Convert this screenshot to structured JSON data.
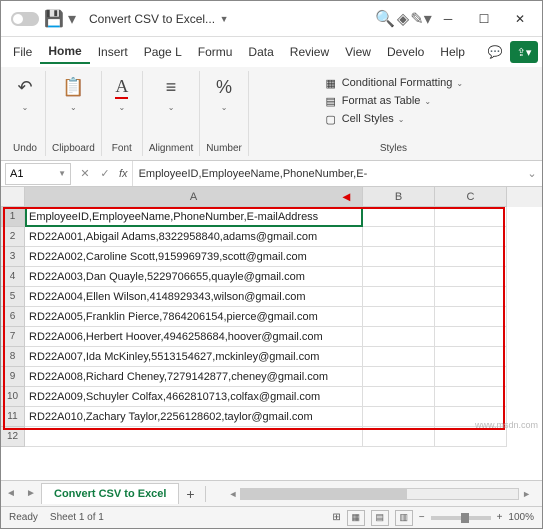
{
  "titlebar": {
    "doc_title": "Convert CSV to Excel..."
  },
  "menubar": {
    "tabs": [
      "File",
      "Home",
      "Insert",
      "Page L",
      "Formu",
      "Data",
      "Review",
      "View",
      "Develo",
      "Help"
    ],
    "active_index": 1
  },
  "ribbon": {
    "undo": "Undo",
    "clipboard": "Clipboard",
    "font": "Font",
    "alignment": "Alignment",
    "number": "Number",
    "styles_label": "Styles",
    "cond_fmt": "Conditional Formatting",
    "fmt_table": "Format as Table",
    "cell_styles": "Cell Styles"
  },
  "formula_bar": {
    "name_box": "A1",
    "content": "EmployeeID,EmployeeName,PhoneNumber,E-"
  },
  "columns": [
    "A",
    "B",
    "C"
  ],
  "rows": [
    {
      "n": 1,
      "a": "EmployeeID,EmployeeName,PhoneNumber,E-mailAddress"
    },
    {
      "n": 2,
      "a": "RD22A001,Abigail Adams,8322958840,adams@gmail.com"
    },
    {
      "n": 3,
      "a": "RD22A002,Caroline Scott,9159969739,scott@gmail.com"
    },
    {
      "n": 4,
      "a": "RD22A003,Dan Quayle,5229706655,quayle@gmail.com"
    },
    {
      "n": 5,
      "a": "RD22A004,Ellen Wilson,4148929343,wilson@gmail.com"
    },
    {
      "n": 6,
      "a": "RD22A005,Franklin Pierce,7864206154,pierce@gmail.com"
    },
    {
      "n": 7,
      "a": "RD22A006,Herbert Hoover,4946258684,hoover@gmail.com"
    },
    {
      "n": 8,
      "a": "RD22A007,Ida McKinley,5513154627,mckinley@gmail.com"
    },
    {
      "n": 9,
      "a": "RD22A008,Richard Cheney,7279142877,cheney@gmail.com"
    },
    {
      "n": 10,
      "a": "RD22A009,Schuyler Colfax,4662810713,colfax@gmail.com"
    },
    {
      "n": 11,
      "a": "RD22A010,Zachary Taylor,2256128602,taylor@gmail.com"
    },
    {
      "n": 12,
      "a": ""
    }
  ],
  "sheet": {
    "name": "Convert CSV to Excel",
    "add": "+"
  },
  "statusbar": {
    "ready": "Ready",
    "sheet_count": "Sheet 1 of 1",
    "zoom": "100%"
  },
  "watermark": "www.msdn.com"
}
